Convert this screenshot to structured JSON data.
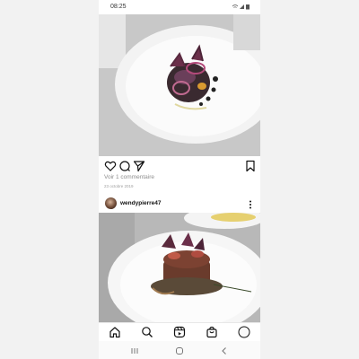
{
  "status_bar": {
    "time": "08:25",
    "icons": "wifi signal battery"
  },
  "post1": {
    "image": "plated-dish-photo",
    "comments_link": "Voir 1 commentaire",
    "date": "23 octobre 2019"
  },
  "post2": {
    "username": "wendypierre47",
    "image": "plated-dish-photo"
  },
  "bottom_nav": [
    "home-icon",
    "search-icon",
    "reels-icon",
    "shop-icon",
    "profile-icon"
  ],
  "system_nav": [
    "recents-icon",
    "home-circle-icon",
    "back-icon"
  ]
}
